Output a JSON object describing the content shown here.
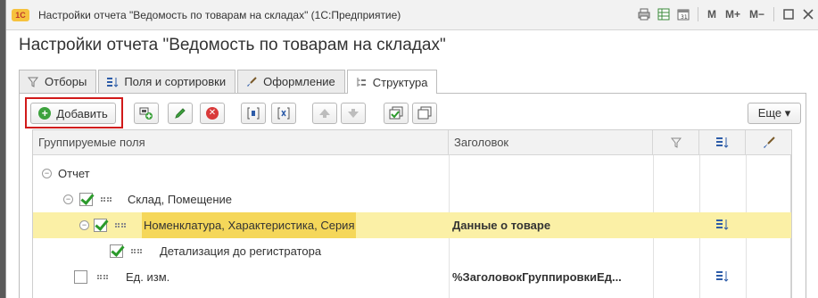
{
  "window": {
    "title": "Настройки отчета \"Ведомость по товарам на складах\"  (1С:Предприятие)",
    "logo_text": "1С",
    "controls": [
      "M",
      "M+",
      "M−"
    ]
  },
  "form": {
    "title": "Настройки отчета \"Ведомость по товарам на складах\""
  },
  "tabs": [
    {
      "label": "Отборы",
      "icon": "filter-icon"
    },
    {
      "label": "Поля и сортировки",
      "icon": "fields-sort-icon"
    },
    {
      "label": "Оформление",
      "icon": "brush-icon"
    },
    {
      "label": "Структура",
      "icon": "structure-icon",
      "active": true
    }
  ],
  "toolbar": {
    "add_label": "Добавить",
    "more_label": "Еще ▾"
  },
  "grid": {
    "columns": [
      "Группируемые поля",
      "Заголовок"
    ],
    "rows": [
      {
        "field": "Отчет",
        "title": "",
        "checked": null
      },
      {
        "field": "Склад, Помещение",
        "title": "",
        "checked": true
      },
      {
        "field": "Номенклатура, Характеристика, Серия",
        "title": "Данные о товаре",
        "checked": true,
        "selected": true
      },
      {
        "field": "Детализация до регистратора",
        "title": "",
        "checked": true
      },
      {
        "field": "Ед. изм.",
        "title": "%ЗаголовокГруппировкиЕд...",
        "checked": false
      }
    ]
  },
  "colors": {
    "selected_row": "#fbf0a6",
    "highlight": "#f5d75a",
    "add_frame": "#d11a1a"
  }
}
